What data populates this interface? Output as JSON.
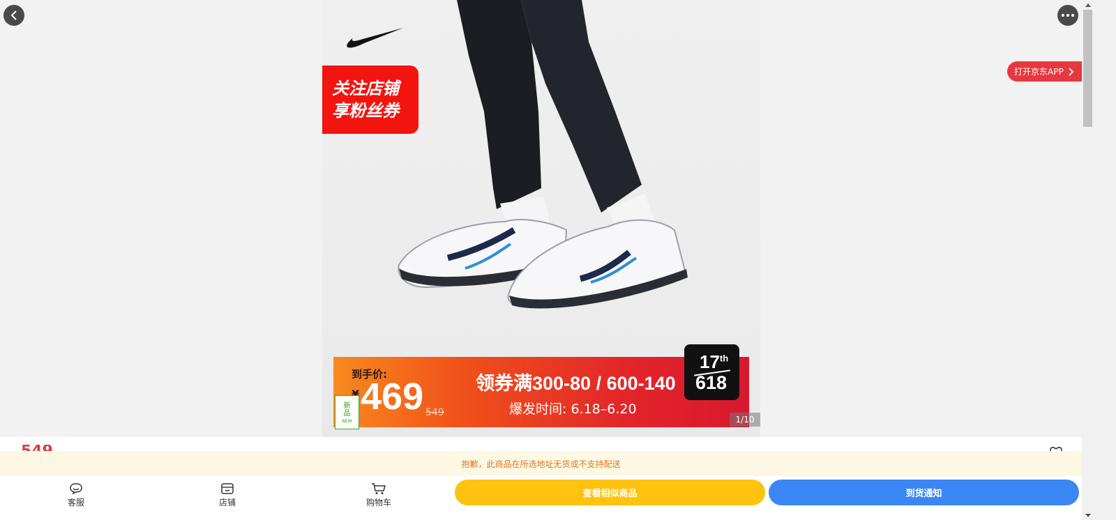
{
  "top_bar": {
    "open_app_label": "打开京东APP",
    "back_icon": "chevron-left-icon",
    "more_icon": "more-dots-icon"
  },
  "hero": {
    "follow_badge_line1": "关注店铺",
    "follow_badge_line2": "享粉丝券",
    "banner_label": "到手价:",
    "banner_currency": "¥",
    "banner_price": "469",
    "banner_original_price": "549",
    "banner_coupon": "领券满300-80 / 600-140",
    "banner_time": "爆发时间: 6.18–6.20",
    "event_badge_line1": "17",
    "event_badge_sup": "th",
    "event_badge_line2": "618",
    "new_badge_cn1": "新",
    "new_badge_cn2": "品",
    "new_badge_en": "NEW",
    "page_indicator": "1/10"
  },
  "detail": {
    "price_peek": "549"
  },
  "notice": {
    "text": "抱歉，此商品在所选地址无货或不支持配送"
  },
  "bottom_bar": {
    "service_label": "客服",
    "shop_label": "店铺",
    "cart_label": "购物车",
    "similar_button": "查看相似商品",
    "notify_button": "到货通知"
  },
  "colors": {
    "brand_red": "#e6393f",
    "similar_yellow": "#ffc20e",
    "notify_blue": "#3a86f5",
    "notice_bg": "#fcf8e3",
    "notice_text": "#e0782a"
  }
}
